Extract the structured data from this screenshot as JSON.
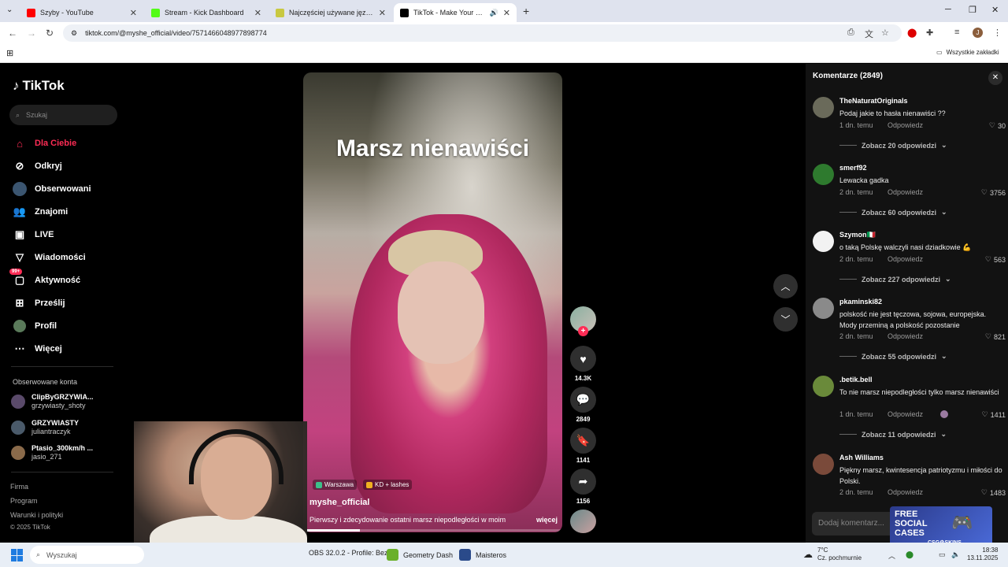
{
  "browser": {
    "tabs": [
      {
        "title": "Szyby - YouTube",
        "color": "#ff0000"
      },
      {
        "title": "Stream - Kick Dashboard",
        "color": "#53fc18"
      },
      {
        "title": "Najczęściej używane języki świ...",
        "color": "#c8c840"
      },
      {
        "title": "TikTok - Make Your Day",
        "color": "#000000"
      }
    ],
    "url": "tiktok.com/@myshe_official/video/7571466048977898774",
    "bookmarks_all": "Wszystkie zakładki",
    "profile_initial": "J"
  },
  "sidebar": {
    "logo": "TikTok",
    "search_placeholder": "Szukaj",
    "menu": [
      {
        "label": "Dla Ciebie",
        "icon": "home-icon"
      },
      {
        "label": "Odkryj",
        "icon": "compass-icon"
      },
      {
        "label": "Obserwowani",
        "icon": "following-avatar-icon"
      },
      {
        "label": "Znajomi",
        "icon": "friends-icon"
      },
      {
        "label": "LIVE",
        "icon": "live-icon"
      },
      {
        "label": "Wiadomości",
        "icon": "messages-icon"
      },
      {
        "label": "Aktywność",
        "icon": "activity-icon"
      },
      {
        "label": "Prześlij",
        "icon": "upload-icon"
      },
      {
        "label": "Profil",
        "icon": "profile-icon"
      },
      {
        "label": "Więcej",
        "icon": "more-icon"
      }
    ],
    "activity_badge": "99+",
    "followed_title": "Obserwowane konta",
    "followed": [
      {
        "name": "ClipByGRZYWIA...",
        "handle": "grzywiasty_shoty"
      },
      {
        "name": "GRZYWIASTY",
        "handle": "juliantraczyk"
      },
      {
        "name": "Ptasio_300km/h ...",
        "handle": "jasio_271"
      }
    ],
    "footer": [
      "Firma",
      "Program",
      "Warunki i polityki",
      "© 2025 TikTok"
    ]
  },
  "video": {
    "overlay_title": "Marsz nienawiści",
    "tags": [
      "Warszawa",
      "KD + lashes"
    ],
    "author": "myshe_official",
    "description": "Pierwszy i zdecydowanie ostatni marsz niepodległości w moim",
    "more": "więcej",
    "progress": 0.22
  },
  "actions": {
    "likes": "14.3K",
    "comments": "2849",
    "saves": "1141",
    "shares": "1156"
  },
  "comments": {
    "header": "Komentarze (2849)",
    "reply_label": "Odpowiedz",
    "input_placeholder": "Dodaj komentarz...",
    "items": [
      {
        "user": "TheNaturatOriginals",
        "text": "Podaj jakie to hasła nienawiści ??",
        "when": "1 dn. temu",
        "likes": "30",
        "more": "Zobacz 20 odpowiedzi"
      },
      {
        "user": "smerf92",
        "text": "Lewacka gadka",
        "when": "2 dn. temu",
        "likes": "3756",
        "more": "Zobacz 60 odpowiedzi"
      },
      {
        "user": "Szymon🇮🇹",
        "text": "o taką Polskę walczyli nasi dziadkowie 💪",
        "when": "2 dn. temu",
        "likes": "563",
        "more": "Zobacz 227 odpowiedzi"
      },
      {
        "user": "pkaminski82",
        "text": "polskość nie jest tęczowa, sojowa, europejska. Mody przeminą a polskość pozostanie",
        "when": "2 dn. temu",
        "likes": "821",
        "more": "Zobacz 55 odpowiedzi"
      },
      {
        "user": ".betik.bell",
        "text": "To nie marsz niepodległości tylko marsz nienawiści",
        "when": "1 dn. temu",
        "likes": "1411",
        "more": "Zobacz 11 odpowiedzi"
      },
      {
        "user": "Ash Williams",
        "text": "Piękny marsz, kwintesencja patriotyzmu i miłości do Polski.",
        "when": "2 dn. temu",
        "likes": "1483",
        "more": ""
      }
    ]
  },
  "ad": {
    "line1": "FREE SOCIAL CASES",
    "brand": "CSG⚙SKINS"
  },
  "taskbar": {
    "search_placeholder": "Wyszukaj",
    "apps": [
      "OBS 32.0.2 - Profile: Bez",
      "Geometry Dash",
      "Maisteros"
    ],
    "temp": "7°C",
    "weather": "Cz. pochmurnie",
    "time": "18:38",
    "date": "13.11.2025"
  },
  "colors": {
    "accent": "#fe2c55",
    "sidebar_bg": "#000000",
    "comments_bg": "#121212"
  }
}
